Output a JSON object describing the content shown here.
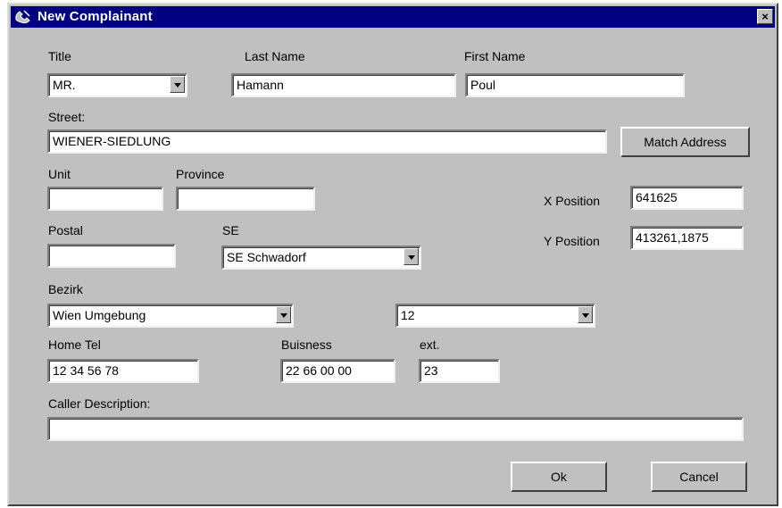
{
  "window": {
    "title": "New Complainant",
    "close_label": "×"
  },
  "labels": {
    "title": "Title",
    "last_name": "Last Name",
    "first_name": "First Name",
    "street": "Street:",
    "unit": "Unit",
    "province": "Province",
    "x_position": "X Position",
    "y_position": "Y Position",
    "postal": "Postal",
    "se": "SE",
    "bezirk": "Bezirk",
    "home_tel": "Home Tel",
    "buisness": "Buisness",
    "ext": "ext.",
    "caller_description": "Caller Description:"
  },
  "fields": {
    "title": "MR.",
    "last_name": "Hamann",
    "first_name": "Poul",
    "street": "WIENER-SIEDLUNG",
    "unit": "",
    "province": "",
    "x_position": "641625",
    "y_position": "413261,1875",
    "postal": "",
    "se": "SE Schwadorf",
    "bezirk": "Wien Umgebung",
    "bezirk_number": "12",
    "home_tel": "12 34 56 78",
    "buisness": "22 66 00 00",
    "ext": "23",
    "caller_description": ""
  },
  "buttons": {
    "match_address": "Match Address",
    "ok": "Ok",
    "cancel": "Cancel"
  }
}
